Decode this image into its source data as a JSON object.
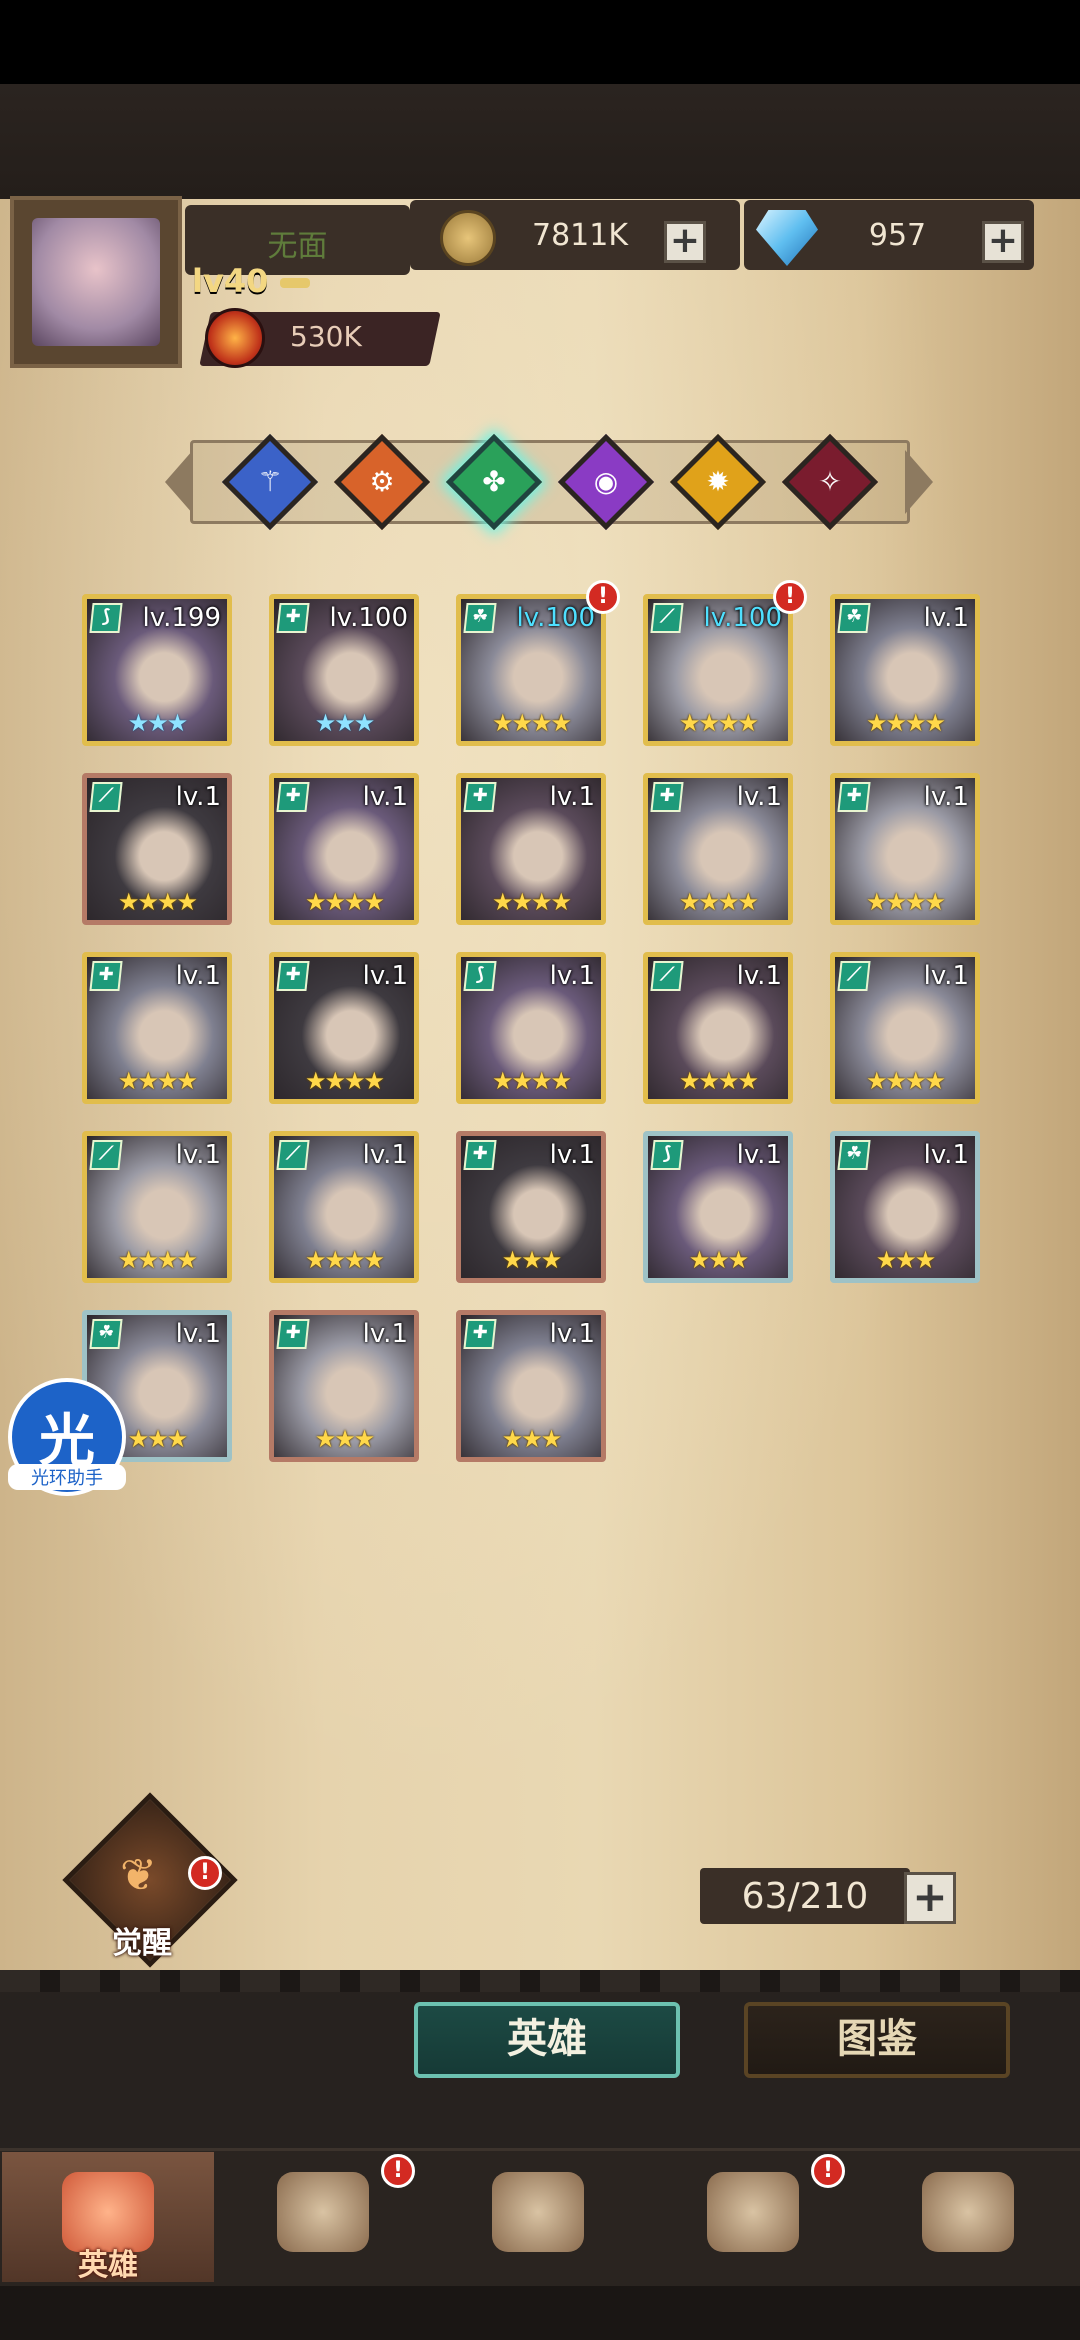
{
  "profile": {
    "name": "无面",
    "level": "lv40",
    "power": "530K"
  },
  "resources": {
    "gold": "7811K",
    "gems": "957",
    "plus": "+"
  },
  "filters": [
    {
      "name": "faction-blue",
      "glyph": "⚚",
      "color": "#3b62c8"
    },
    {
      "name": "faction-orange",
      "glyph": "⚙",
      "color": "#d8632a"
    },
    {
      "name": "faction-green",
      "glyph": "✤",
      "color": "#2aa15a",
      "selected": true
    },
    {
      "name": "faction-purple",
      "glyph": "◉",
      "color": "#8a3bc4"
    },
    {
      "name": "faction-yellow",
      "glyph": "✹",
      "color": "#e0a21a"
    },
    {
      "name": "faction-crimson",
      "glyph": "✧",
      "color": "#7a1c2e"
    }
  ],
  "heroes": [
    {
      "lv": "lv.199",
      "stars": "★★★",
      "frame": "gold",
      "tag": "⟆",
      "starColor": "blue"
    },
    {
      "lv": "lv.100",
      "stars": "★★★",
      "frame": "gold",
      "tag": "✚",
      "starColor": "blue"
    },
    {
      "lv": "lv.100",
      "stars": "★★★★",
      "frame": "gold",
      "tag": "☘",
      "cyan": true,
      "alert": true
    },
    {
      "lv": "lv.100",
      "stars": "★★★★",
      "frame": "gold",
      "tag": "⟋",
      "cyan": true,
      "alert": true
    },
    {
      "lv": "lv.1",
      "stars": "★★★★",
      "frame": "gold",
      "tag": "☘"
    },
    {
      "lv": "lv.1",
      "stars": "★★★★",
      "frame": "red",
      "tag": "⟋"
    },
    {
      "lv": "lv.1",
      "stars": "★★★★",
      "frame": "gold",
      "tag": "✚"
    },
    {
      "lv": "lv.1",
      "stars": "★★★★",
      "frame": "gold",
      "tag": "✚"
    },
    {
      "lv": "lv.1",
      "stars": "★★★★",
      "frame": "gold",
      "tag": "✚"
    },
    {
      "lv": "lv.1",
      "stars": "★★★★",
      "frame": "gold",
      "tag": "✚"
    },
    {
      "lv": "lv.1",
      "stars": "★★★★",
      "frame": "gold",
      "tag": "✚"
    },
    {
      "lv": "lv.1",
      "stars": "★★★★",
      "frame": "gold",
      "tag": "✚"
    },
    {
      "lv": "lv.1",
      "stars": "★★★★",
      "frame": "gold",
      "tag": "⟆"
    },
    {
      "lv": "lv.1",
      "stars": "★★★★",
      "frame": "gold",
      "tag": "⟋"
    },
    {
      "lv": "lv.1",
      "stars": "★★★★",
      "frame": "gold",
      "tag": "⟋"
    },
    {
      "lv": "lv.1",
      "stars": "★★★★",
      "frame": "gold",
      "tag": "⟋"
    },
    {
      "lv": "lv.1",
      "stars": "★★★★",
      "frame": "gold",
      "tag": "⟋"
    },
    {
      "lv": "lv.1",
      "stars": "★★★",
      "frame": "red",
      "tag": "✚"
    },
    {
      "lv": "lv.1",
      "stars": "★★★",
      "frame": "blue",
      "tag": "⟆"
    },
    {
      "lv": "lv.1",
      "stars": "★★★",
      "frame": "blue",
      "tag": "☘"
    },
    {
      "lv": "lv.1",
      "stars": "★★★",
      "frame": "blue",
      "tag": "☘"
    },
    {
      "lv": "lv.1",
      "stars": "★★★",
      "frame": "red",
      "tag": "✚"
    },
    {
      "lv": "lv.1",
      "stars": "★★★",
      "frame": "red",
      "tag": "✚"
    }
  ],
  "helper": {
    "glyph": "光",
    "label": "光环助手"
  },
  "awaken": {
    "label": "觉醒",
    "glyph": "❦"
  },
  "capacity": "63/210",
  "tabs": {
    "heroes": "英雄",
    "codex": "图鉴"
  },
  "nav": [
    {
      "label": "英雄",
      "active": true
    },
    {
      "label": "",
      "alert": true
    },
    {
      "label": ""
    },
    {
      "label": "",
      "alert": true
    },
    {
      "label": ""
    }
  ],
  "alert_mark": "!"
}
